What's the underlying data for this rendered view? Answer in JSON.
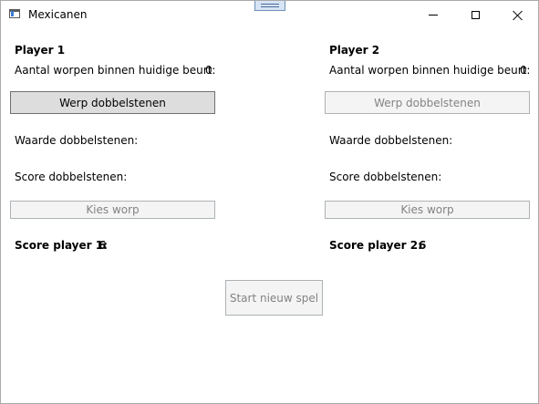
{
  "window": {
    "title": "Mexicanen"
  },
  "player1": {
    "heading": "Player 1",
    "throws_label": "Aantal worpen binnen huidige beurt:",
    "throws_value": "0",
    "roll_button": "Werp dobbelstenen",
    "dice_value_label": "Waarde dobbelstenen:",
    "dice_score_label": "Score dobbelstenen:",
    "choose_button": "Kies worp",
    "score_label": "Score player 1:",
    "score_value": "6"
  },
  "player2": {
    "heading": "Player 2",
    "throws_label": "Aantal worpen binnen huidige beurt:",
    "throws_value": "0",
    "roll_button": "Werp dobbelstenen",
    "dice_value_label": "Waarde dobbelstenen:",
    "dice_score_label": "Score dobbelstenen:",
    "choose_button": "Kies worp",
    "score_label": "Score player 2:",
    "score_value": "6"
  },
  "new_game_button": "Start nieuw spel",
  "colors": {
    "enabled_button_bg": "#dddddd",
    "disabled_button_bg": "#f4f4f4",
    "disabled_text": "#838383"
  },
  "icons": {
    "app": "window-app-icon",
    "minimize": "minimize-icon",
    "maximize": "maximize-icon",
    "close": "close-icon"
  }
}
